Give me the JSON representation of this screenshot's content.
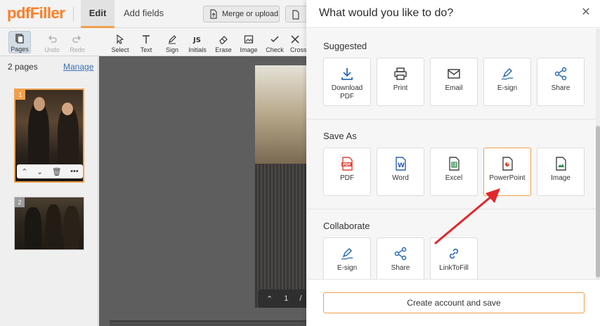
{
  "app": {
    "logo": "pdfFiller",
    "tabs": [
      "Edit",
      "Add fields"
    ],
    "merge_label": "Merge or upload"
  },
  "toolbar": {
    "tools": [
      {
        "label": "Pages",
        "icon": "pages-icon"
      },
      {
        "label": "Undo",
        "icon": "undo-icon"
      },
      {
        "label": "Redo",
        "icon": "redo-icon"
      },
      {
        "label": "Select",
        "icon": "cursor-icon"
      },
      {
        "label": "Text",
        "icon": "text-icon"
      },
      {
        "label": "Sign",
        "icon": "pen-icon"
      },
      {
        "label": "Initials",
        "icon": "initials-icon"
      },
      {
        "label": "Erase",
        "icon": "eraser-icon"
      },
      {
        "label": "Image",
        "icon": "image-icon"
      },
      {
        "label": "Check",
        "icon": "check-icon"
      },
      {
        "label": "Cross",
        "icon": "cross-icon"
      }
    ]
  },
  "leftpanel": {
    "pages_count": "2 pages",
    "manage_label": "Manage",
    "thumbs": [
      {
        "num": "1"
      },
      {
        "num": "2"
      }
    ],
    "thumb_controls": [
      "⌃",
      "⌄",
      "🗑",
      "•••"
    ]
  },
  "canvas": {
    "page_number": "1",
    "page_sep": "/"
  },
  "modal": {
    "title": "What would you like to do?",
    "close_symbol": "✕",
    "sections": {
      "suggested": {
        "title": "Suggested",
        "items": [
          "Download PDF",
          "Print",
          "Email",
          "E-sign",
          "Share"
        ]
      },
      "save_as": {
        "title": "Save As",
        "items": [
          "PDF",
          "Word",
          "Excel",
          "PowerPoint",
          "Image"
        ]
      },
      "collaborate": {
        "title": "Collaborate",
        "items": [
          "E-sign",
          "Share",
          "LinkToFill"
        ]
      }
    },
    "footer_button": "Create account and save"
  },
  "colors": {
    "accent": "#f0a04b",
    "logo": "#ff7d26",
    "link": "#3b6fb6",
    "arrow": "#e3262b",
    "pdf": "#e0453a",
    "word": "#2b5fb4",
    "excel": "#2e8a4a",
    "powerpoint": "#d9482b"
  }
}
